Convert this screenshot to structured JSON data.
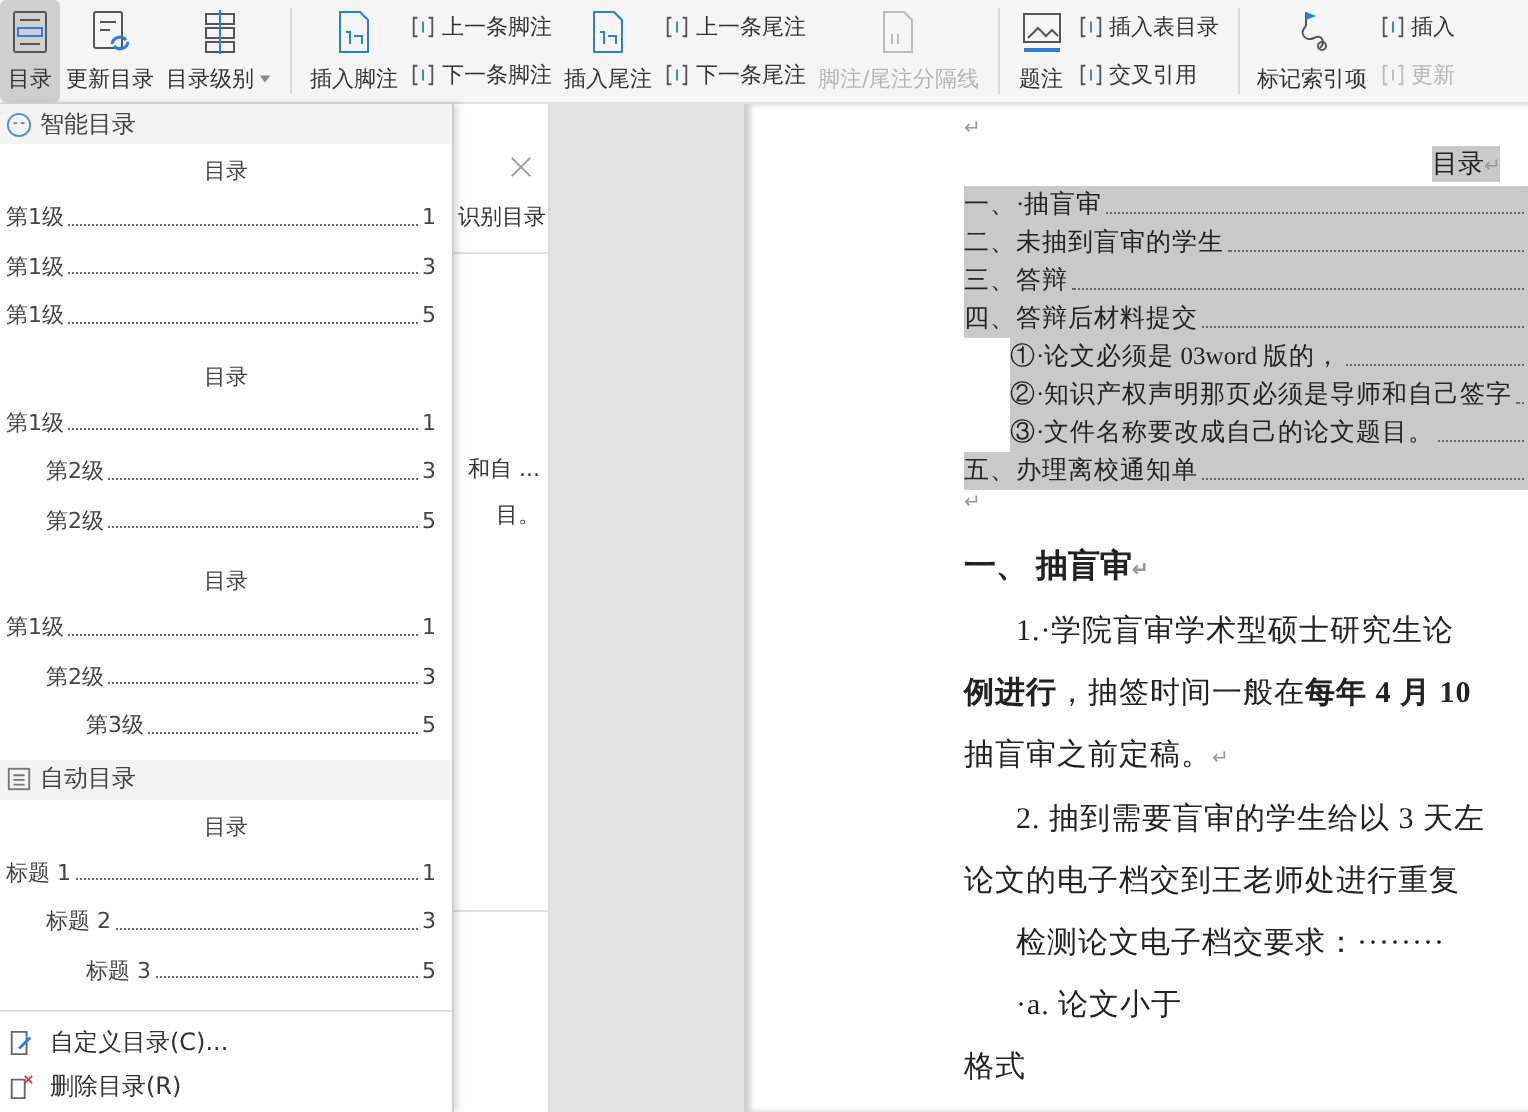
{
  "toolbar": {
    "groups": [
      [
        {
          "kind": "large",
          "label": "目录",
          "selected": true,
          "disabled": false,
          "has_menu": false
        },
        {
          "kind": "large",
          "label": "更新目录",
          "selected": false,
          "disabled": false,
          "has_menu": false
        },
        {
          "kind": "large",
          "label": "目录级别",
          "selected": false,
          "disabled": false,
          "has_menu": true
        }
      ],
      [
        {
          "kind": "large",
          "label": "插入脚注",
          "selected": false,
          "disabled": false,
          "has_menu": false
        },
        {
          "kind": "stack",
          "rows": [
            {
              "label": "上一条脚注",
              "disabled": false
            },
            {
              "label": "下一条脚注",
              "disabled": false
            }
          ]
        },
        {
          "kind": "large",
          "label": "插入尾注",
          "selected": false,
          "disabled": false,
          "has_menu": false
        },
        {
          "kind": "stack",
          "rows": [
            {
              "label": "上一条尾注",
              "disabled": false
            },
            {
              "label": "下一条尾注",
              "disabled": false
            }
          ]
        },
        {
          "kind": "large",
          "label": "脚注/尾注分隔线",
          "selected": false,
          "disabled": true,
          "has_menu": false
        }
      ],
      [
        {
          "kind": "large",
          "label": "题注",
          "selected": false,
          "disabled": false,
          "has_menu": false
        },
        {
          "kind": "stack",
          "rows": [
            {
              "label": "插入表目录",
              "disabled": false
            },
            {
              "label": "交叉引用",
              "disabled": false
            }
          ]
        }
      ],
      [
        {
          "kind": "large",
          "label": "标记索引项",
          "selected": false,
          "disabled": false,
          "has_menu": false
        },
        {
          "kind": "stack",
          "rows": [
            {
              "label": "插入",
              "disabled": false
            },
            {
              "label": "更新",
              "disabled": true
            }
          ]
        }
      ]
    ]
  },
  "toc_menu": {
    "sections": [
      {
        "kind": "smart",
        "title": "智能目录",
        "templates": [
          {
            "title": "目录",
            "entries": [
              {
                "label": "第1级",
                "page": "1"
              },
              {
                "label": "第1级",
                "page": "3"
              },
              {
                "label": "第1级",
                "page": "5"
              }
            ]
          },
          {
            "title": "目录",
            "entries": [
              {
                "label": "第1级",
                "page": "1",
                "children": [
                  {
                    "label": "第2级",
                    "page": "3"
                  },
                  {
                    "label": "第2级",
                    "page": "5"
                  }
                ]
              }
            ]
          },
          {
            "title": "目录",
            "entries": [
              {
                "label": "第1级",
                "page": "1",
                "children": [
                  {
                    "label": "第2级",
                    "page": "3",
                    "children": [
                      {
                        "label": "第3级",
                        "page": "5"
                      }
                    ]
                  }
                ]
              }
            ]
          }
        ]
      },
      {
        "kind": "auto",
        "title": "自动目录",
        "templates": [
          {
            "title": "目录",
            "entries": [
              {
                "label": "标题 1",
                "page": "1",
                "children": [
                  {
                    "label": "标题 2",
                    "page": "3",
                    "children": [
                      {
                        "label": "标题 3",
                        "page": "5"
                      }
                    ]
                  }
                ]
              }
            ]
          }
        ]
      }
    ],
    "actions": [
      {
        "kind": "custom",
        "label": "自定义目录(C)..."
      },
      {
        "kind": "delete",
        "label": "删除目录(R)"
      }
    ]
  },
  "side_panel": {
    "title": "识别目录",
    "card_lines": [
      "和自 ...",
      "目。"
    ]
  },
  "document": {
    "top_mark": "↵",
    "toc_title": "目录",
    "toc_title_mark": "↵",
    "toc": [
      {
        "text": "一、·抽盲审"
      },
      {
        "text": "二、未抽到盲审的学生"
      },
      {
        "text": "三、答辩"
      },
      {
        "text": "四、答辩后材料提交",
        "children": [
          {
            "text": "①·论文必须是 03word 版的，"
          },
          {
            "text": "②·知识产权声明那页必须是导师和自己签字"
          },
          {
            "text": "③·文件名称要改成自己的论文题目。"
          }
        ]
      },
      {
        "text": "五、办理离校通知单"
      }
    ],
    "after_toc_mark": "↵",
    "heading": {
      "text": "一、 抽盲审",
      "mark": "↵"
    },
    "paragraphs": [
      {
        "text": "1.·学院盲审学术型硕士研究生论",
        "indent": true
      },
      {
        "text": "**例进行**，抽签时间一般在**每年 4 月 10**",
        "indent": false
      },
      {
        "text": "抽盲审之前定稿。",
        "indent": false,
        "mark": "↵"
      },
      {
        "text": "2. 抽到需要盲审的学生给以 3 天左",
        "indent": true
      },
      {
        "text": "论文的电子档交到王老师处进行重复",
        "indent": false
      },
      {
        "text": "检测论文电子档交要求：········",
        "indent": true
      },
      {
        "text": "·a. 论文小于",
        "indent": true
      },
      {
        "text": "格式",
        "indent": false
      }
    ]
  }
}
